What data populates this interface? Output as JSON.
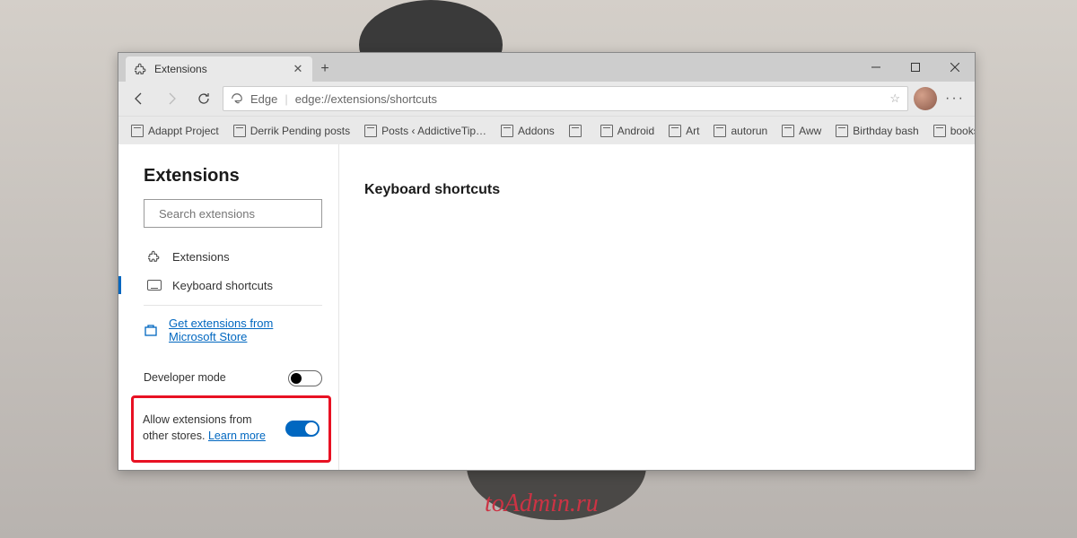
{
  "tab": {
    "title": "Extensions"
  },
  "address": {
    "label": "Edge",
    "url": "edge://extensions/shortcuts"
  },
  "bookmarks": [
    "Adappt Project",
    "Derrik Pending posts",
    "Posts ‹ AddictiveTip…",
    "Addons",
    "",
    "Android",
    "Art",
    "autorun",
    "Aww",
    "Birthday bash",
    "books"
  ],
  "sidebar": {
    "title": "Extensions",
    "search_placeholder": "Search extensions",
    "nav": {
      "extensions": "Extensions",
      "shortcuts": "Keyboard shortcuts"
    },
    "store_link": "Get extensions from Microsoft Store",
    "developer_mode": "Developer mode",
    "allow_other": "Allow extensions from other stores.",
    "learn_more": "Learn more"
  },
  "main": {
    "heading": "Keyboard shortcuts"
  },
  "watermark": "toAdmin.ru"
}
